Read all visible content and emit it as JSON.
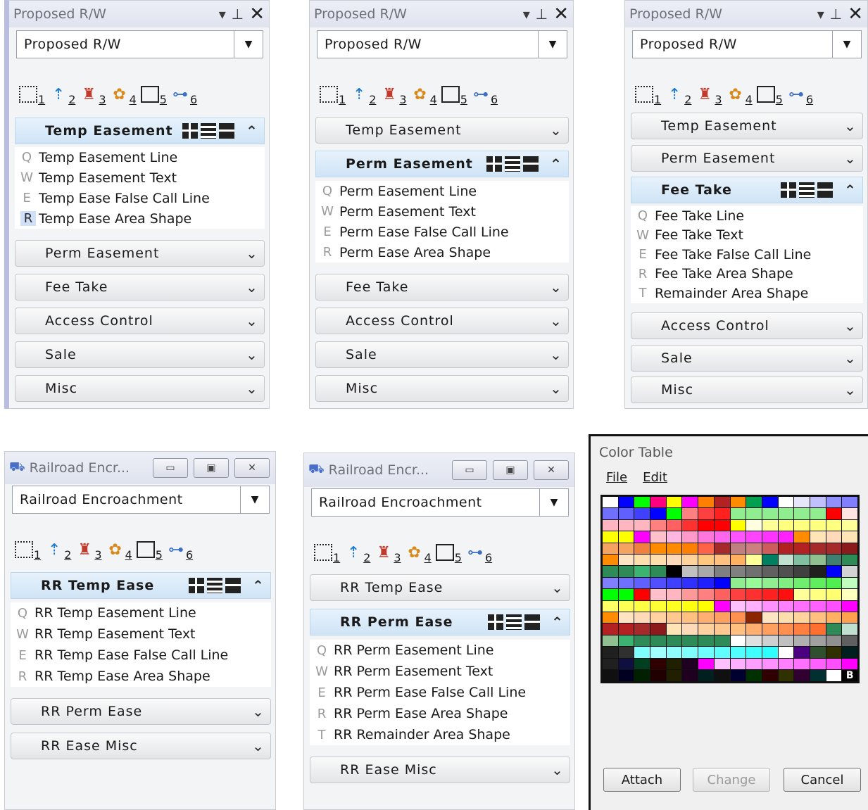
{
  "panels": [
    {
      "title": "Proposed R/W",
      "dropdown": "Proposed R/W",
      "sections": [
        {
          "label": "Temp Easement",
          "open": true,
          "items": [
            {
              "key": "Q",
              "label": "Temp Easement Line"
            },
            {
              "key": "W",
              "label": "Temp Easement Text"
            },
            {
              "key": "E",
              "label": "Temp Ease False Call Line"
            },
            {
              "key": "R",
              "label": "Temp Ease Area Shape",
              "highlight": true
            }
          ]
        },
        {
          "label": "Perm Easement"
        },
        {
          "label": "Fee Take"
        },
        {
          "label": "Access Control"
        },
        {
          "label": "Sale"
        },
        {
          "label": "Misc"
        }
      ]
    },
    {
      "title": "Proposed R/W",
      "dropdown": "Proposed R/W",
      "sections": [
        {
          "label": "Temp Easement"
        },
        {
          "label": "Perm Easement",
          "open": true,
          "items": [
            {
              "key": "Q",
              "label": "Perm Easement Line"
            },
            {
              "key": "W",
              "label": "Perm Easement Text"
            },
            {
              "key": "E",
              "label": "Perm Ease False Call Line"
            },
            {
              "key": "R",
              "label": "Perm Ease Area Shape"
            }
          ]
        },
        {
          "label": "Fee Take"
        },
        {
          "label": "Access Control"
        },
        {
          "label": "Sale"
        },
        {
          "label": "Misc"
        }
      ]
    },
    {
      "title": "Proposed R/W",
      "dropdown": "Proposed R/W",
      "sections": [
        {
          "label": "Temp Easement"
        },
        {
          "label": "Perm Easement"
        },
        {
          "label": "Fee Take",
          "open": true,
          "items": [
            {
              "key": "Q",
              "label": "Fee Take Line"
            },
            {
              "key": "W",
              "label": "Fee Take Text"
            },
            {
              "key": "E",
              "label": "Fee Take False Call Line"
            },
            {
              "key": "R",
              "label": "Fee Take Area Shape"
            },
            {
              "key": "T",
              "label": "Remainder Area Shape"
            }
          ]
        },
        {
          "label": "Access Control"
        },
        {
          "label": "Sale"
        },
        {
          "label": "Misc"
        }
      ]
    },
    {
      "title": "Railroad Encr...",
      "dropdown": "Railroad Encroachment",
      "sections": [
        {
          "label": "RR Temp Ease",
          "open": true,
          "items": [
            {
              "key": "Q",
              "label": "RR Temp Easement Line"
            },
            {
              "key": "W",
              "label": "RR Temp Easement Text"
            },
            {
              "key": "E",
              "label": "RR Temp Ease False Call Line"
            },
            {
              "key": "R",
              "label": "RR Temp Ease Area Shape"
            }
          ]
        },
        {
          "label": "RR Perm Ease"
        },
        {
          "label": "RR Ease Misc"
        }
      ]
    },
    {
      "title": "Railroad Encr...",
      "dropdown": "Railroad Encroachment",
      "sections": [
        {
          "label": "RR Temp Ease"
        },
        {
          "label": "RR Perm Ease",
          "open": true,
          "items": [
            {
              "key": "Q",
              "label": "RR Perm Easement Line"
            },
            {
              "key": "W",
              "label": "RR Perm Easement Text"
            },
            {
              "key": "E",
              "label": "RR Perm Ease False Call Line"
            },
            {
              "key": "R",
              "label": "RR Perm Ease Area Shape"
            },
            {
              "key": "T",
              "label": "RR Remainder Area Shape"
            }
          ]
        },
        {
          "label": "RR Ease Misc"
        }
      ]
    }
  ],
  "tool_numbers": [
    "1",
    "2",
    "3",
    "4",
    "5",
    "6"
  ],
  "color_table": {
    "title": "Color Table",
    "menu": [
      "File",
      "Edit"
    ],
    "buttons": {
      "attach": "Attach",
      "change": "Change",
      "cancel": "Cancel"
    },
    "last_cell_label": "B",
    "rows": [
      [
        "#ffffff",
        "#0000ff",
        "#00ff00",
        "#ff0080",
        "#ffff00",
        "#ff00ff",
        "#ff8000",
        "#b22222",
        "#ff8c00",
        "#00a050",
        "#0000ff",
        "#ffffff",
        "#e6e6fa",
        "#c0c0ff",
        "#9090ff",
        "#8080ff"
      ],
      [
        "#7070ff",
        "#6060ff",
        "#4040ff",
        "#0000ff",
        "#00ff00",
        "#ff8080",
        "#ff4040",
        "#ff2020",
        "#90ee90",
        "#90ee90",
        "#90ee90",
        "#90ee90",
        "#90ee90",
        "#90ee90",
        "#ff0000",
        "#ffe4e1"
      ],
      [
        "#ffb6c1",
        "#ffb6c1",
        "#ffb6c1",
        "#ff8080",
        "#ff6060",
        "#ff3030",
        "#ff0000",
        "#ff0000",
        "#ffff00",
        "#ffffe0",
        "#ffff99",
        "#ffff80",
        "#ffff80",
        "#ffff80",
        "#ffff80",
        "#ffff99"
      ],
      [
        "#ffff00",
        "#ffff00",
        "#ff00ff",
        "#ffc0cb",
        "#ffb6e1",
        "#ff99cc",
        "#ff77dd",
        "#ff66ee",
        "#ff55ff",
        "#ff44ff",
        "#ff33ff",
        "#ff22ff",
        "#ff8c00",
        "#ffe4b5",
        "#ffdab9",
        "#ffe4b5"
      ],
      [
        "#f4a460",
        "#f4a460",
        "#f08040",
        "#ff8c00",
        "#ff8c00",
        "#ff7f00",
        "#ff6347",
        "#a52a2a",
        "#c08080",
        "#cd8080",
        "#cd5c5c",
        "#b22222",
        "#b22222",
        "#a52a2a",
        "#a52a2a",
        "#8b1a1a"
      ],
      [
        "#ff8c00",
        "#ffe4c4",
        "#ffdead",
        "#ffdead",
        "#ffdab9",
        "#ffd39b",
        "#ffc87c",
        "#ffc080",
        "#ffb060",
        "#ffff99",
        "#008060",
        "#c0e0d0",
        "#80c0a0",
        "#90c090",
        "#408070",
        "#2e8b57"
      ],
      [
        "#2e8b57",
        "#2e8b57",
        "#3cb371",
        "#2e8b57",
        "#000000",
        "#c0c0c0",
        "#a9a9a9",
        "#808080",
        "#808080",
        "#707070",
        "#606060",
        "#505050",
        "#404040",
        "#202020",
        "#0000ff",
        "#d3d3d3"
      ],
      [
        "#8080ff",
        "#7070ff",
        "#6060ff",
        "#5050ff",
        "#4040ff",
        "#3030ff",
        "#2020ff",
        "#0000ff",
        "#90ee90",
        "#98fb98",
        "#90ee90",
        "#80ee80",
        "#70ee70",
        "#60ee60",
        "#50ee50",
        "#c0ffc0"
      ],
      [
        "#00ff00",
        "#00ff00",
        "#ff0000",
        "#ffc0cb",
        "#ffb6c1",
        "#ff9999",
        "#ff8080",
        "#ff6060",
        "#ff4040",
        "#ff3030",
        "#ff2020",
        "#ff1010",
        "#ffff99",
        "#ffff80",
        "#ffff70",
        "#ffffc0"
      ],
      [
        "#ffff66",
        "#ffff55",
        "#ffff44",
        "#ffff33",
        "#ffff22",
        "#ffff11",
        "#ffff00",
        "#ff00ff",
        "#ffc0ff",
        "#ffb0ff",
        "#ff90ff",
        "#ff80ff",
        "#ff70ff",
        "#ff60ff",
        "#ff50ff",
        "#ff00ff"
      ],
      [
        "#ff8c00",
        "#ffe4c4",
        "#ffdab9",
        "#ffd0a0",
        "#ffc890",
        "#ffc080",
        "#ffb070",
        "#ffa060",
        "#ff9050",
        "#8b2500",
        "#ffe4c4",
        "#ffdead",
        "#ffd39b",
        "#ffc080",
        "#ffb060",
        "#ffa050"
      ],
      [
        "#b22222",
        "#b22222",
        "#a52a2a",
        "#8b1a1a",
        "#ffe4b5",
        "#ffdab9",
        "#ffd0a0",
        "#ffc890",
        "#ffc080",
        "#ffb070",
        "#ffa060",
        "#ff9050",
        "#ff8040",
        "#ff7030",
        "#2e8b57",
        "#c0e0d0"
      ],
      [
        "#90c090",
        "#3cb371",
        "#2e8b57",
        "#2e8b57",
        "#2e8b57",
        "#2e8b57",
        "#2e8b57",
        "#2e8b57",
        "#ffffff",
        "#e0e0e0",
        "#d0d0d0",
        "#c0c0c0",
        "#b0b0b0",
        "#a0a0a0",
        "#909090",
        "#606060"
      ],
      [
        "#202020",
        "#303030",
        "#80ffff",
        "#a0ffff",
        "#90ffff",
        "#80ffff",
        "#70ffff",
        "#60ffff",
        "#50ffff",
        "#40ffff",
        "#30ffff",
        "#ffffff",
        "#4b0082",
        "#2f4f2f",
        "#2f2f00",
        "#002020"
      ],
      [
        "#202020",
        "#101040",
        "#004020",
        "#300000",
        "#202000",
        "#200020",
        "#ff00ff",
        "#ffc0ff",
        "#ffb0ff",
        "#ffa0ff",
        "#ff90ff",
        "#ff80ff",
        "#ff70ff",
        "#ff60ff",
        "#ff50ff",
        "#ff00ff"
      ],
      [
        "#101010",
        "#000020",
        "#002000",
        "#200000",
        "#202000",
        "#200020",
        "#002020",
        "#101010",
        "#000030",
        "#003000",
        "#300000",
        "#303000",
        "#300030",
        "#003030",
        "#ffffff",
        "#000000"
      ]
    ]
  }
}
